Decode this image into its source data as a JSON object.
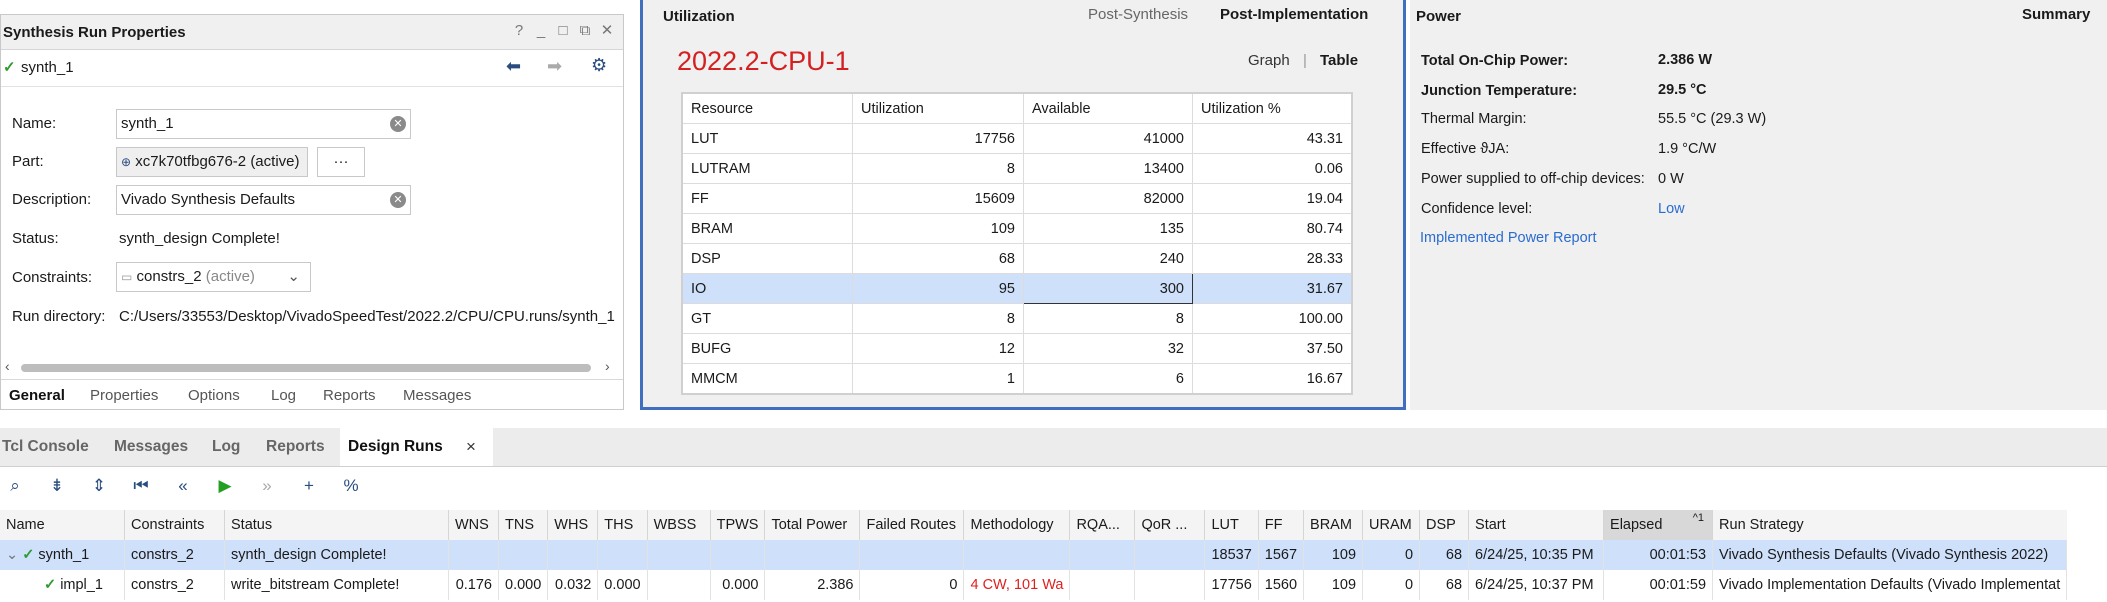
{
  "props": {
    "title": "Synthesis Run Properties",
    "controls": [
      "?",
      "_",
      "□",
      "⧉",
      "✕"
    ],
    "run_name": "synth_1",
    "fields": {
      "name_label": "Name:",
      "name_value": "synth_1",
      "part_label": "Part:",
      "part_value": "xc7k70tfbg676-2 (active)",
      "part_browse": "···",
      "desc_label": "Description:",
      "desc_value": "Vivado Synthesis Defaults",
      "status_label": "Status:",
      "status_value": "synth_design Complete!",
      "constraints_label": "Constraints:",
      "constraints_value": "constrs_2",
      "constraints_suffix": "(active)",
      "rundir_label": "Run directory:",
      "rundir_value": "C:/Users/33553/Desktop/VivadoSpeedTest/2022.2/CPU/CPU.runs/synth_1"
    },
    "tabs": [
      "General",
      "Properties",
      "Options",
      "Log",
      "Reports",
      "Messages"
    ]
  },
  "util": {
    "title": "Utilization",
    "view_tabs": [
      "Post-Synthesis",
      "Post-Implementation"
    ],
    "device": "2022.2-CPU-1",
    "mode": [
      "Graph",
      "Table"
    ],
    "headers": [
      "Resource",
      "Utilization",
      "Available",
      "Utilization %"
    ],
    "rows": [
      [
        "LUT",
        "17756",
        "41000",
        "43.31"
      ],
      [
        "LUTRAM",
        "8",
        "13400",
        "0.06"
      ],
      [
        "FF",
        "15609",
        "82000",
        "19.04"
      ],
      [
        "BRAM",
        "109",
        "135",
        "80.74"
      ],
      [
        "DSP",
        "68",
        "240",
        "28.33"
      ],
      [
        "IO",
        "95",
        "300",
        "31.67"
      ],
      [
        "GT",
        "8",
        "8",
        "100.00"
      ],
      [
        "BUFG",
        "12",
        "32",
        "37.50"
      ],
      [
        "MMCM",
        "1",
        "6",
        "16.67"
      ]
    ]
  },
  "power": {
    "title": "Power",
    "summary": "Summary",
    "items": [
      {
        "label": "Total On-Chip Power:",
        "value": "2.386 W"
      },
      {
        "label": "Junction Temperature:",
        "value": "29.5 °C"
      },
      {
        "label": "Thermal Margin:",
        "value": "55.5 °C (29.3 W)"
      },
      {
        "label": "Effective ϑJA:",
        "value": "1.9 °C/W"
      },
      {
        "label": "Power supplied to off-chip devices:",
        "value": "0 W"
      },
      {
        "label": "Confidence level:",
        "value": "Low"
      }
    ],
    "report_link": "Implemented Power Report"
  },
  "bottom": {
    "tabs": [
      "Tcl Console",
      "Messages",
      "Log",
      "Reports",
      "Design Runs"
    ],
    "close": "×",
    "headers": [
      "Name",
      "Constraints",
      "Status",
      "WNS",
      "TNS",
      "WHS",
      "THS",
      "WBSS",
      "TPWS",
      "Total Power",
      "Failed Routes",
      "Methodology",
      "RQA...",
      "QoR ...",
      "LUT",
      "FF",
      "BRAM",
      "URAM",
      "DSP",
      "Start",
      "Elapsed",
      "Run Strategy"
    ],
    "sort_marker": "^1",
    "runs": [
      [
        "synth_1",
        "constrs_2",
        "synth_design Complete!",
        "",
        "",
        "",
        "",
        "",
        "",
        "",
        "",
        "",
        "",
        "",
        "18537",
        "1567",
        "109",
        "0",
        "68",
        "6/24/25, 10:35 PM",
        "00:01:53",
        "Vivado Synthesis Defaults (Vivado Synthesis 2022)"
      ],
      [
        "impl_1",
        "constrs_2",
        "write_bitstream Complete!",
        "0.176",
        "0.000",
        "0.032",
        "0.000",
        "",
        "0.000",
        "2.386",
        "0",
        "4 CW, 101 Wa",
        "",
        "",
        "17756",
        "1560",
        "109",
        "0",
        "68",
        "6/24/25, 10:37 PM",
        "00:01:59",
        "Vivado Implementation Defaults (Vivado Implementat"
      ]
    ]
  }
}
